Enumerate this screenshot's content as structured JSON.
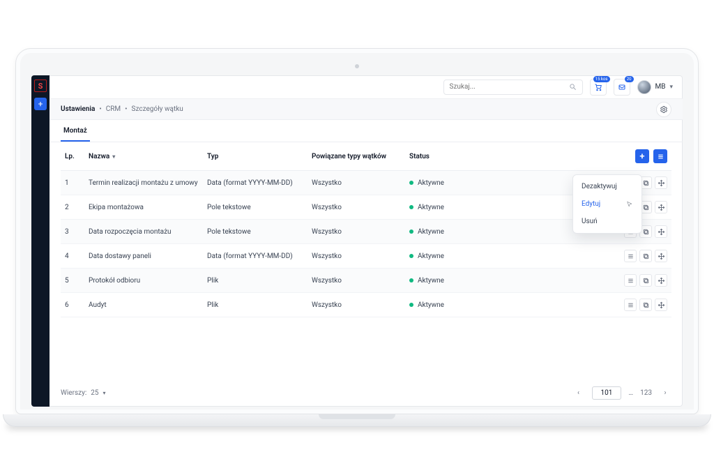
{
  "breadcrumbs": {
    "root": "Ustawienia",
    "mid": "CRM",
    "leaf": "Szczegóły wątku"
  },
  "search": {
    "placeholder": "Szukaj..."
  },
  "notifications": {
    "count1": "15 kos",
    "count2": "20"
  },
  "user": {
    "initials": "MB"
  },
  "tab": {
    "label": "Montaż"
  },
  "columns": {
    "lp": "Lp.",
    "name": "Nazwa",
    "typ": "Typ",
    "pow": "Powiązane typy wątków",
    "stat": "Status"
  },
  "rows": [
    {
      "lp": "1",
      "name": "Termin realizacji montażu z umowy",
      "typ": "Data (format YYYY-MM-DD)",
      "pow": "Wszystko",
      "stat": "Aktywne"
    },
    {
      "lp": "2",
      "name": "Ekipa montażowa",
      "typ": "Pole tekstowe",
      "pow": "Wszystko",
      "stat": "Aktywne"
    },
    {
      "lp": "3",
      "name": "Data rozpoczęcia montażu",
      "typ": "Pole tekstowe",
      "pow": "Wszystko",
      "stat": "Aktywne"
    },
    {
      "lp": "4",
      "name": "Data dostawy paneli",
      "typ": "Data (format YYYY-MM-DD)",
      "pow": "Wszystko",
      "stat": "Aktywne"
    },
    {
      "lp": "5",
      "name": "Protokół odbioru",
      "typ": "Plik",
      "pow": "Wszystko",
      "stat": "Aktywne"
    },
    {
      "lp": "6",
      "name": "Audyt",
      "typ": "Plik",
      "pow": "Wszystko",
      "stat": "Aktywne"
    }
  ],
  "footer": {
    "rows_label": "Wierszy:",
    "rows_value": "25"
  },
  "pager": {
    "current": "101",
    "last": "123"
  },
  "ctx": {
    "deactivate": "Dezaktywuj",
    "edit": "Edytuj",
    "delete": "Usuń"
  }
}
